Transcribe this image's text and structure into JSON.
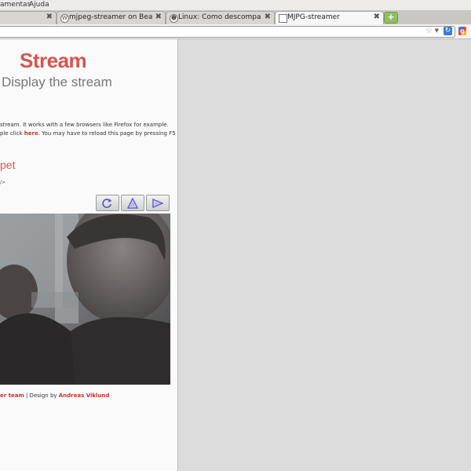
{
  "menubar": {
    "items": [
      "amentas",
      "Ajuda"
    ]
  },
  "tabs": [
    {
      "title": "mjpeg-streamer on BeagleB…",
      "icon": "wordpress-icon"
    },
    {
      "title": "Linux: Como descompactar…",
      "icon": "tux-icon"
    },
    {
      "title": "MJPG-streamer",
      "icon": "page-icon"
    }
  ],
  "page": {
    "title": "Stream",
    "subtitle": "Display the stream",
    "para_line1": "stream. It works with a few browsers like Firefox for example.",
    "para_line2_prefix": "ple click ",
    "para_link": "here",
    "para_line2_suffix": ". You may have to reload this page by pressing F5",
    "heading": "pet",
    "snippet": "/>",
    "footer_link1": "er team",
    "footer_sep": " | Design by ",
    "footer_link2": "Andreas Viklund"
  },
  "colors": {
    "accent": "#d9534f",
    "link": "#cc2f2f"
  }
}
